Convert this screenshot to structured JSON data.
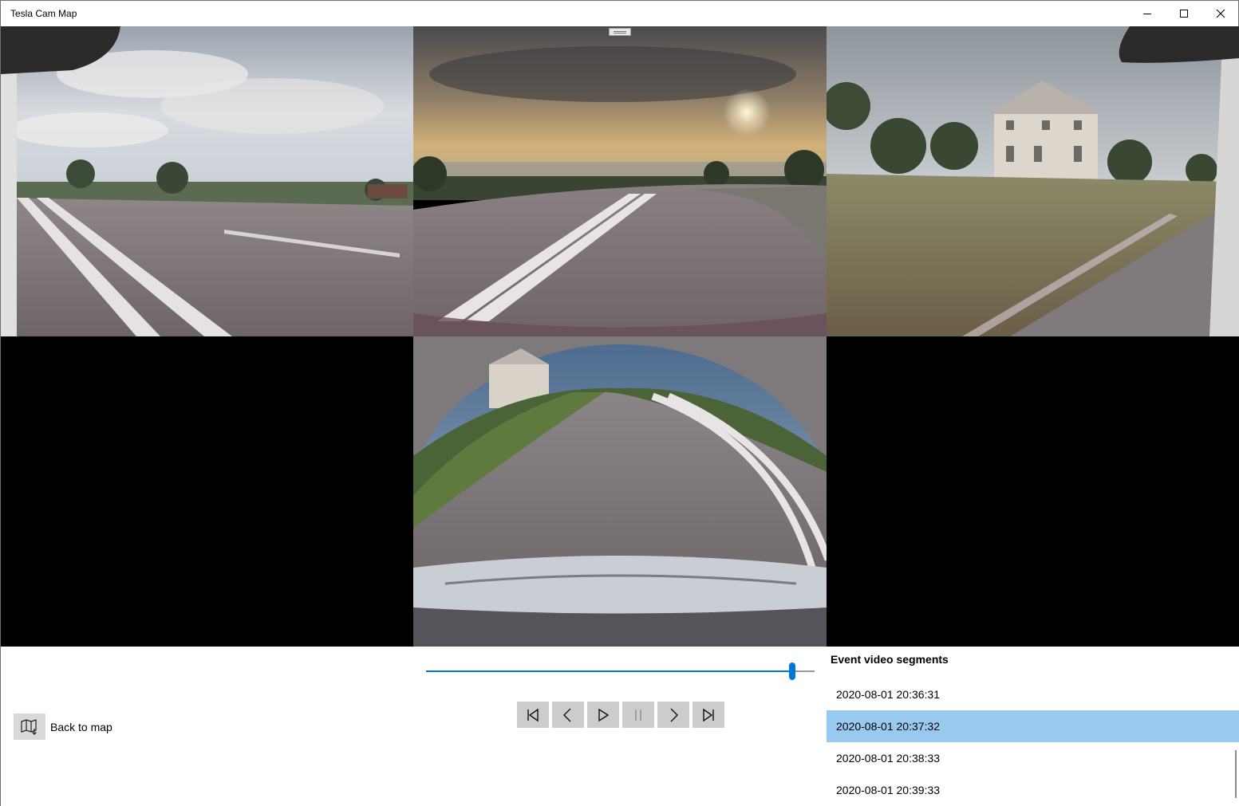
{
  "window": {
    "title": "Tesla Cam Map",
    "caption_buttons": [
      "minimize",
      "maximize",
      "close"
    ]
  },
  "cameras": [
    {
      "name": "left",
      "icon": "camera-left"
    },
    {
      "name": "front",
      "icon": "camera-front"
    },
    {
      "name": "right",
      "icon": "camera-right"
    },
    {
      "name": "back",
      "icon": "camera-back"
    }
  ],
  "playback": {
    "position_fraction": 0.95,
    "accent_color": "#0078d7",
    "buttons": [
      {
        "name": "skip-to-start",
        "icon": "skip-start-icon",
        "enabled": true
      },
      {
        "name": "previous",
        "icon": "chevron-left-icon",
        "enabled": true
      },
      {
        "name": "play",
        "icon": "play-icon",
        "enabled": true
      },
      {
        "name": "pause",
        "icon": "pause-icon",
        "enabled": false
      },
      {
        "name": "next",
        "icon": "chevron-right-icon",
        "enabled": true
      },
      {
        "name": "skip-to-end",
        "icon": "skip-end-icon",
        "enabled": true
      }
    ]
  },
  "back_to_map": {
    "label": "Back to map",
    "icon": "map-icon"
  },
  "segments": {
    "header": "Event video segments",
    "items": [
      {
        "label": "2020-08-01 20:36:31",
        "selected": false
      },
      {
        "label": "2020-08-01 20:37:32",
        "selected": true
      },
      {
        "label": "2020-08-01 20:38:33",
        "selected": false
      },
      {
        "label": "2020-08-01 20:39:33",
        "selected": false
      }
    ],
    "selected_color": "#99c9ef"
  }
}
